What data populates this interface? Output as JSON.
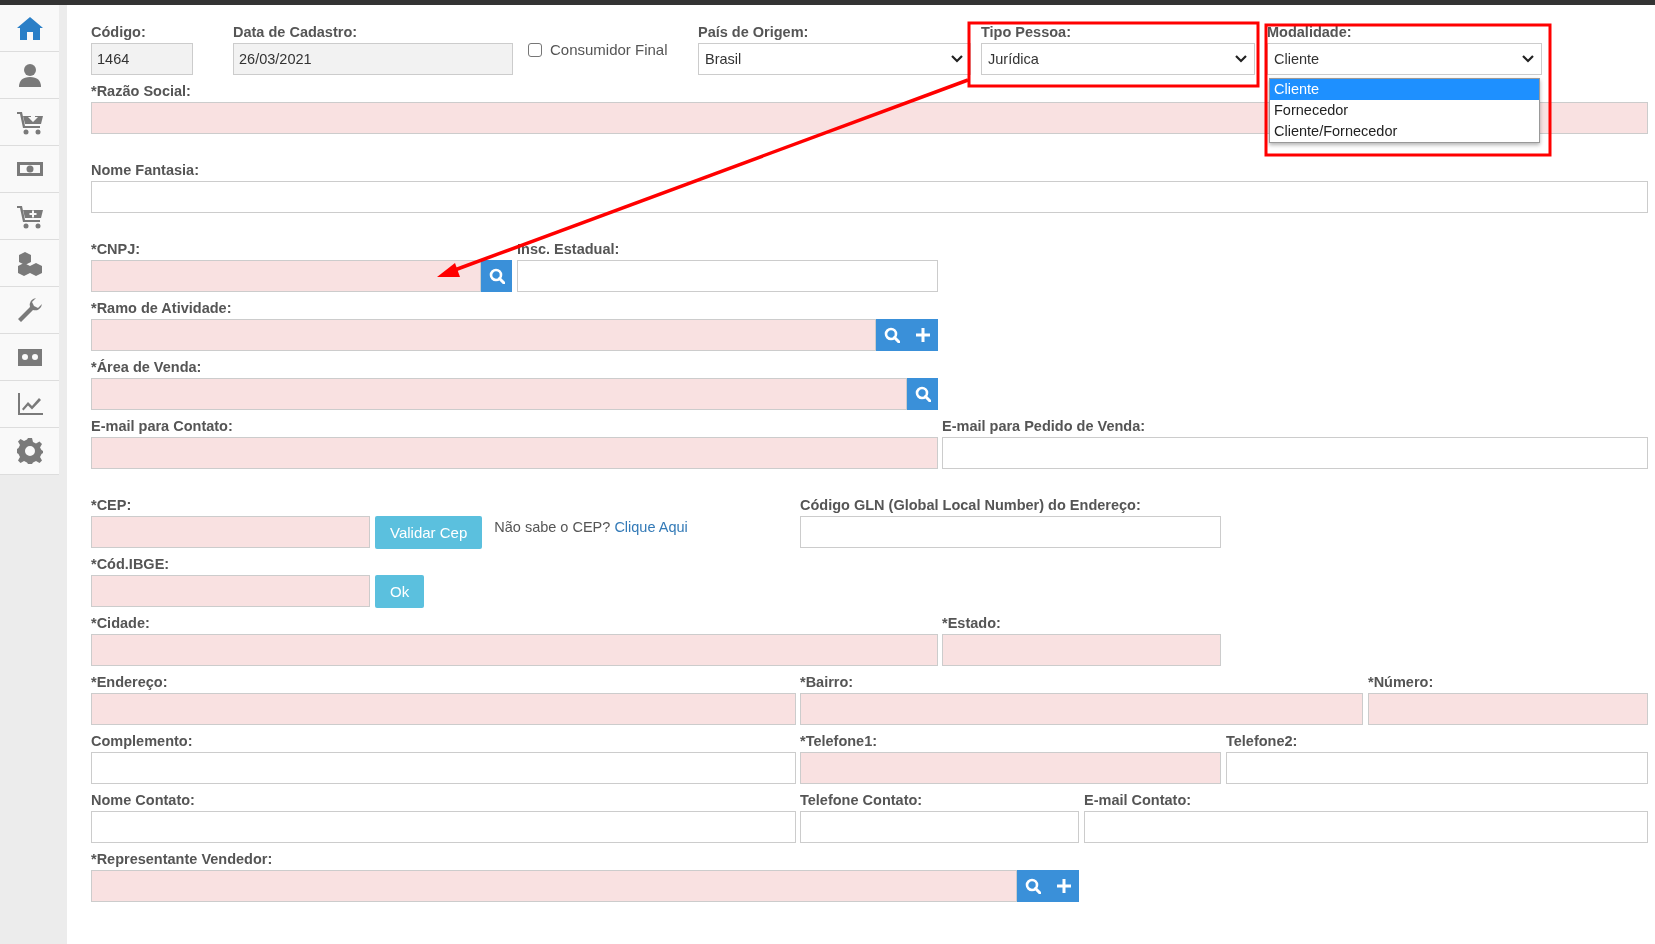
{
  "sidebar": {
    "items": [
      {
        "selected": true
      },
      {
        "selected": false
      },
      {
        "selected": false
      },
      {
        "selected": false
      },
      {
        "selected": false
      },
      {
        "selected": false
      },
      {
        "selected": false
      },
      {
        "selected": false
      },
      {
        "selected": false
      },
      {
        "selected": false
      }
    ]
  },
  "form": {
    "rows": [
      {
        "fields": [
          {
            "kind": "text",
            "label": "Código:",
            "value": "1464",
            "disabled": true,
            "highlighted": false
          },
          {
            "kind": "text",
            "label": "Data de Cadastro:",
            "value": "26/03/2021",
            "disabled": true,
            "highlighted": false
          },
          {
            "kind": "checkbox",
            "label": "Consumidor Final",
            "checked": false
          },
          {
            "kind": "select",
            "label": "País de Origem:",
            "value": "Brasil",
            "disabled": false,
            "highlighted": false
          },
          {
            "kind": "select",
            "label": "Tipo Pessoa:",
            "value": "Jurídica",
            "disabled": false,
            "highlighted": false
          },
          {
            "kind": "select",
            "label": "Modalidade:",
            "value": "Cliente",
            "disabled": false,
            "highlighted": false,
            "expanded": true,
            "options": [
              {
                "label": "Cliente",
                "selected": true
              },
              {
                "label": "Fornecedor",
                "selected": false
              },
              {
                "label": "Cliente/Fornecedor",
                "selected": false
              }
            ]
          }
        ]
      },
      {
        "fields": [
          {
            "kind": "text",
            "label": "*Razão Social:",
            "disabled": false,
            "highlighted": true
          }
        ]
      },
      {
        "fields": [
          {
            "kind": "text",
            "label": "Nome Fantasia:",
            "disabled": false,
            "highlighted": false
          }
        ]
      },
      {
        "fields": [
          {
            "kind": "lookup",
            "label": "*CNPJ:",
            "disabled": false,
            "highlighted": true,
            "actions": [
              {
                "kind": "search"
              }
            ]
          },
          {
            "kind": "text",
            "label": "Insc. Estadual:",
            "disabled": false,
            "highlighted": false
          }
        ]
      },
      {
        "fields": [
          {
            "kind": "lookup",
            "label": "*Ramo de Atividade:",
            "disabled": false,
            "highlighted": true,
            "actions": [
              {
                "kind": "search"
              },
              {
                "kind": "add"
              }
            ]
          }
        ]
      },
      {
        "fields": [
          {
            "kind": "lookup",
            "label": "*Área de Venda:",
            "disabled": false,
            "highlighted": true,
            "actions": [
              {
                "kind": "search"
              }
            ]
          }
        ]
      },
      {
        "fields": [
          {
            "kind": "text",
            "label": "E-mail para Contato:",
            "disabled": false,
            "highlighted": true
          },
          {
            "kind": "text",
            "label": "E-mail para Pedido de Venda:",
            "disabled": false,
            "highlighted": false
          }
        ]
      },
      {
        "fields": [
          {
            "kind": "text",
            "label": "*CEP:",
            "disabled": false,
            "highlighted": true,
            "button": "Validar Cep",
            "help": "Não sabe o CEP?",
            "link": "Clique Aqui"
          },
          {
            "kind": "text",
            "label": "Código GLN (Global Local Number) do Endereço:",
            "disabled": false,
            "highlighted": false
          }
        ]
      },
      {
        "fields": [
          {
            "kind": "text",
            "label": "*Cód.IBGE:",
            "disabled": false,
            "highlighted": true,
            "button": "Ok"
          }
        ]
      },
      {
        "fields": [
          {
            "kind": "text",
            "label": "*Cidade:",
            "disabled": false,
            "highlighted": true
          },
          {
            "kind": "text",
            "label": "*Estado:",
            "disabled": false,
            "highlighted": true
          }
        ]
      },
      {
        "fields": [
          {
            "kind": "text",
            "label": "*Endereço:",
            "disabled": false,
            "highlighted": true
          },
          {
            "kind": "text",
            "label": "*Bairro:",
            "disabled": false,
            "highlighted": true
          },
          {
            "kind": "text",
            "label": "*Número:",
            "disabled": false,
            "highlighted": true
          }
        ]
      },
      {
        "fields": [
          {
            "kind": "text",
            "label": "Complemento:",
            "disabled": false,
            "highlighted": false
          },
          {
            "kind": "text",
            "label": "*Telefone1:",
            "disabled": false,
            "highlighted": true
          },
          {
            "kind": "text",
            "label": "Telefone2:",
            "disabled": false,
            "highlighted": false
          }
        ]
      },
      {
        "fields": [
          {
            "kind": "text",
            "label": "Nome Contato:",
            "disabled": false,
            "highlighted": false
          },
          {
            "kind": "text",
            "label": "Telefone Contato:",
            "disabled": false,
            "highlighted": false
          },
          {
            "kind": "text",
            "label": "E-mail Contato:",
            "disabled": false,
            "highlighted": false
          }
        ]
      },
      {
        "fields": [
          {
            "kind": "lookup",
            "label": "*Representante Vendedor:",
            "disabled": false,
            "highlighted": true,
            "actions": [
              {
                "kind": "search"
              },
              {
                "kind": "add"
              }
            ]
          }
        ]
      }
    ]
  }
}
